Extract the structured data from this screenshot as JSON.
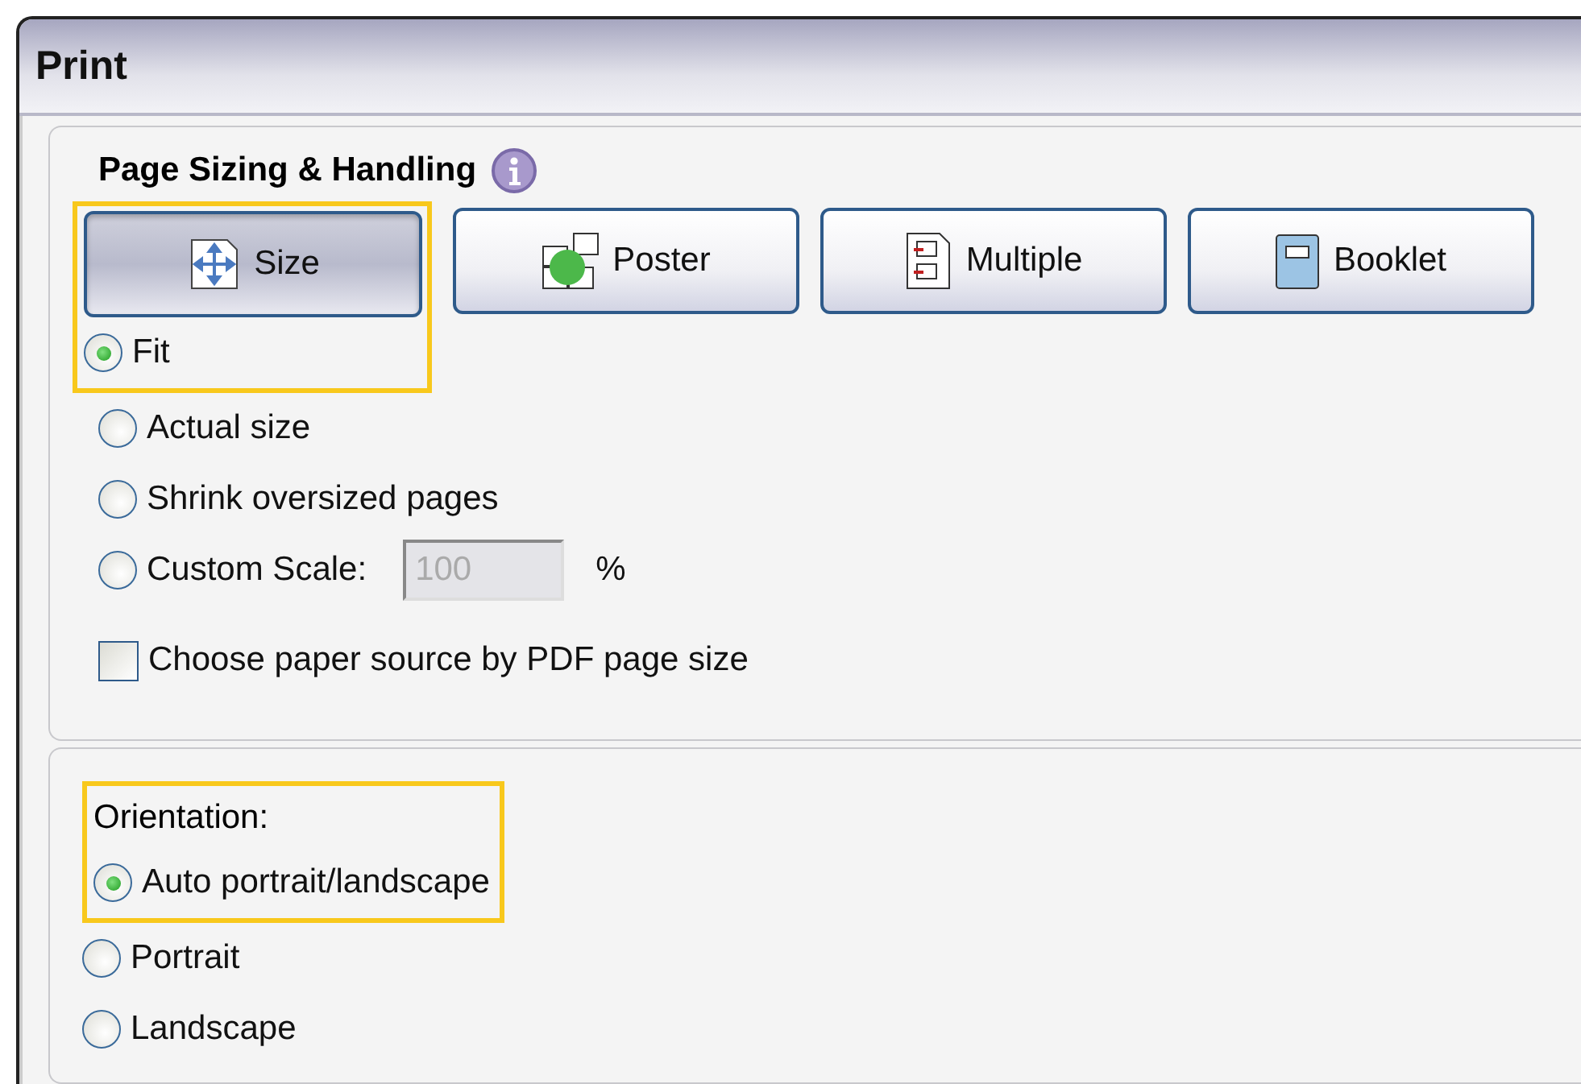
{
  "window": {
    "title": "Print"
  },
  "page_sizing": {
    "heading": "Page Sizing & Handling",
    "highlighted": true,
    "modes": [
      {
        "label": "Size",
        "kind": "size",
        "selected": true
      },
      {
        "label": "Poster",
        "kind": "poster",
        "selected": false
      },
      {
        "label": "Multiple",
        "kind": "multiple",
        "selected": false
      },
      {
        "label": "Booklet",
        "kind": "booklet",
        "selected": false
      }
    ],
    "scale_options": [
      {
        "label": "Fit",
        "selected": true
      },
      {
        "label": "Actual size",
        "selected": false
      },
      {
        "label": "Shrink oversized pages",
        "selected": false
      },
      {
        "label": "Custom Scale:",
        "selected": false
      }
    ],
    "custom_scale": {
      "value": "100",
      "unit": "%",
      "disabled": true
    },
    "paper_source": {
      "label": "Choose paper source by PDF page size",
      "checked": false
    }
  },
  "orientation": {
    "label": "Orientation:",
    "highlighted": true,
    "options": [
      {
        "label": "Auto portrait/landscape",
        "selected": true
      },
      {
        "label": "Portrait",
        "selected": false
      },
      {
        "label": "Landscape",
        "selected": false
      }
    ]
  }
}
